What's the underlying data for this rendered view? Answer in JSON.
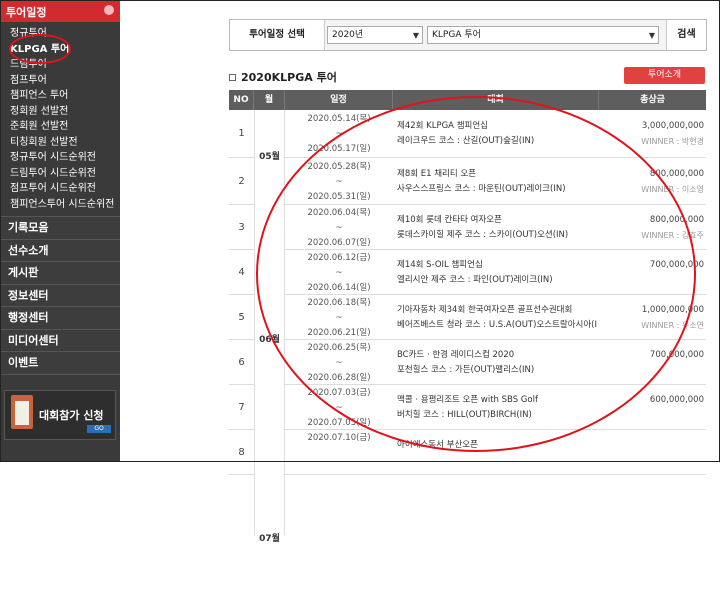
{
  "sidebar": {
    "header": "투어일정",
    "sub_items": [
      {
        "label": "정규투어",
        "active": false
      },
      {
        "label": "KLPGA 투어",
        "active": true
      },
      {
        "label": "드림투어",
        "active": false
      },
      {
        "label": "점프투어",
        "active": false
      },
      {
        "label": "챔피언스 투어",
        "active": false
      },
      {
        "label": "정회원 선발전",
        "active": false
      },
      {
        "label": "준회원 선발전",
        "active": false
      },
      {
        "label": "티칭회원 선발전",
        "active": false
      },
      {
        "label": "정규투어 시드순위전",
        "active": false
      },
      {
        "label": "드림투어 시드순위전",
        "active": false
      },
      {
        "label": "점프투어 시드순위전",
        "active": false
      },
      {
        "label": "챔피언스투어 시드순위전",
        "active": false
      }
    ],
    "main_items": [
      "기록모음",
      "선수소개",
      "게시판",
      "정보센터",
      "행정센터",
      "미디어센터",
      "이벤트"
    ],
    "banner": {
      "label": "대회참가 신청",
      "go": "GO"
    }
  },
  "search": {
    "label": "투어일정 선택",
    "year": "2020년",
    "tour": "KLPGA 투어",
    "button": "검색"
  },
  "section": {
    "title": "2020KLPGA 투어",
    "intro_button": "투어소개"
  },
  "table": {
    "headers": [
      "NO",
      "월",
      "일정",
      "대회",
      "총상금"
    ],
    "months": [
      "05월",
      "06월",
      "07월"
    ],
    "rows": [
      {
        "no": "1",
        "date_start": "2020.05.14(목)",
        "tilde": "~",
        "date_end": "2020.05.17(일)",
        "event": "제42회 KLPGA 챔피언십",
        "course": "레이크우드   코스 : 산길(OUT)숲길(IN)",
        "prize": "3,000,000,000",
        "winner": "WINNER : 박현경"
      },
      {
        "no": "2",
        "date_start": "2020.05.28(목)",
        "tilde": "~",
        "date_end": "2020.05.31(일)",
        "event": "제8회 E1 채리티 오픈",
        "course": "사우스스프링스   코스 : 마운틴(OUT)레이크(IN)",
        "prize": "800,000,000",
        "winner": "WINNER : 이소영"
      },
      {
        "no": "3",
        "date_start": "2020.06.04(목)",
        "tilde": "~",
        "date_end": "2020.06.07(일)",
        "event": "제10회 롯데 칸타타 여자오픈",
        "course": "롯데스카이힐 제주   코스 : 스카이(OUT)오션(IN)",
        "prize": "800,000,000",
        "winner": "WINNER : 김효주"
      },
      {
        "no": "4",
        "date_start": "2020.06.12(금)",
        "tilde": "~",
        "date_end": "2020.06.14(일)",
        "event": "제14회 S-OIL 챔피언십",
        "course": "엘리시안 제주   코스 : 파인(OUT)레이크(IN)",
        "prize": "700,000,000",
        "winner": ""
      },
      {
        "no": "5",
        "date_start": "2020.06.18(목)",
        "tilde": "~",
        "date_end": "2020.06.21(일)",
        "event": "기아자동차 제34회 한국여자오픈 골프선수권대회",
        "course": "베어즈베스트 청라   코스 : U.S.A(OUT)오스트랄아시아(IN)",
        "prize": "1,000,000,000",
        "winner": "WINNER : 유소연"
      },
      {
        "no": "6",
        "date_start": "2020.06.25(목)",
        "tilde": "~",
        "date_end": "2020.06.28(일)",
        "event": "BC카드 · 한경 레이디스컵 2020",
        "course": "포천힐스   코스 : 가든(OUT)팰리스(IN)",
        "prize": "700,000,000",
        "winner": ""
      },
      {
        "no": "7",
        "date_start": "2020.07.03(금)",
        "tilde": "~",
        "date_end": "2020.07.05(일)",
        "event": "맥콜 · 용평리조트 오픈 with SBS Golf",
        "course": "버치힐   코스 : HILL(OUT)BIRCH(IN)",
        "prize": "600,000,000",
        "winner": ""
      },
      {
        "no": "8",
        "date_start": "2020.07.10(금)",
        "tilde": "",
        "date_end": "",
        "event": "아이에스동서 부산오픈",
        "course": "",
        "prize": "",
        "winner": ""
      }
    ]
  }
}
